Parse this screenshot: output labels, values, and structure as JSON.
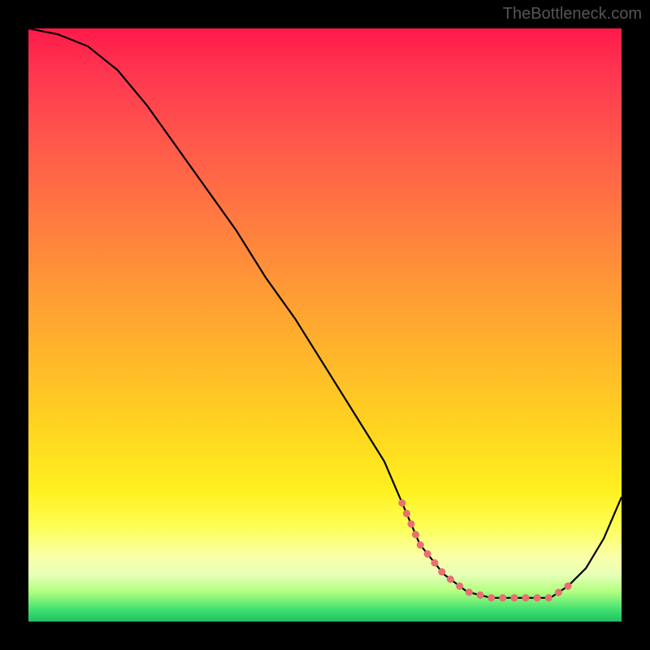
{
  "watermark": "TheBottleneck.com",
  "chart_data": {
    "type": "line",
    "title": "",
    "xlabel": "",
    "ylabel": "",
    "xlim": [
      0,
      100
    ],
    "ylim": [
      0,
      100
    ],
    "series": [
      {
        "name": "curve",
        "x": [
          0,
          5,
          10,
          15,
          20,
          25,
          30,
          35,
          40,
          45,
          50,
          55,
          60,
          63,
          66,
          70,
          74,
          78,
          82,
          85,
          88,
          91,
          94,
          97,
          100
        ],
        "values": [
          100,
          99,
          97,
          93,
          87,
          80,
          73,
          66,
          58,
          51,
          43,
          35,
          27,
          20,
          13,
          8,
          5,
          4,
          4,
          4,
          4,
          6,
          9,
          14,
          21
        ]
      }
    ],
    "annotations": {
      "dot_segment_x_range": [
        63,
        91
      ],
      "dot_color": "#e87070"
    },
    "background_gradient": [
      "#ff1a4a",
      "#ffd620",
      "#fdff55",
      "#20c060"
    ]
  }
}
